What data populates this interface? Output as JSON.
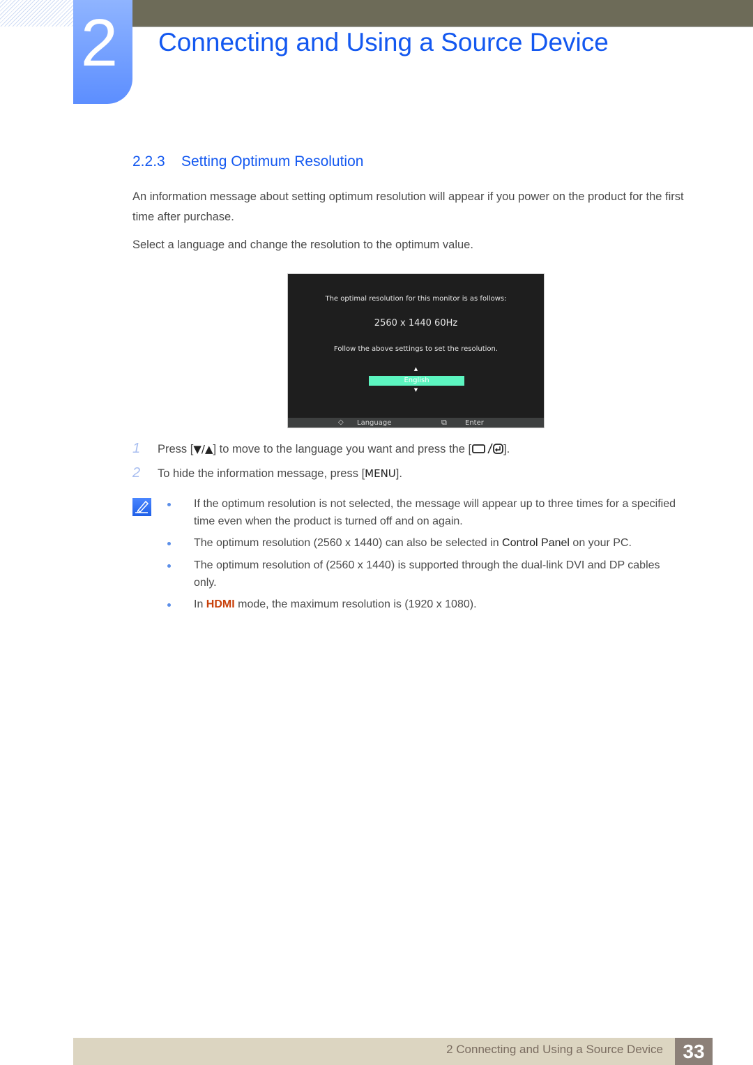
{
  "header": {
    "chapter_number": "2",
    "chapter_title": "Connecting and Using a Source Device"
  },
  "section": {
    "number": "2.2.3",
    "title": "Setting Optimum Resolution"
  },
  "paragraphs": [
    "An information message about setting optimum resolution will appear if you power on the product for the first time after purchase.",
    "Select a language and change the resolution to the optimum value."
  ],
  "osd": {
    "line1": "The optimal resolution for this monitor is as follows:",
    "resolution": "2560 x 1440  60Hz",
    "line3": "Follow the above settings to set the resolution.",
    "selected_language": "English",
    "footer_language_label": "Language",
    "footer_enter_label": "Enter",
    "accent_color": "#5cf5c0"
  },
  "steps": [
    {
      "num": "1",
      "before": "Press [",
      "keys": "▼/▲",
      "middle": "] to move to the language you want and press the [",
      "after": "]."
    },
    {
      "num": "2",
      "before": "To hide the information message, press [",
      "keys": "MENU",
      "after": "]."
    }
  ],
  "notes": [
    {
      "text": "If the optimum resolution is not selected, the message will appear up to three times for a specified time even when the product is turned off and on again."
    },
    {
      "before": "The optimum resolution (2560 x 1440) can also be selected in ",
      "strong": "Control Panel",
      "after": " on your PC."
    },
    {
      "text": "The optimum resolution of (2560 x 1440) is supported through the dual-link DVI and DP cables only."
    },
    {
      "before": "In ",
      "strong": "HDMI",
      "after": " mode, the maximum resolution is (1920 x 1080)."
    }
  ],
  "footer": {
    "text": "2 Connecting and Using a Source Device",
    "page": "33"
  },
  "colors": {
    "heading_blue": "#1358f0",
    "header_bar": "#6d6b58",
    "footer_bar": "#dcd5c1",
    "page_box": "#8c8078",
    "hdmi_orange": "#c8400a"
  }
}
